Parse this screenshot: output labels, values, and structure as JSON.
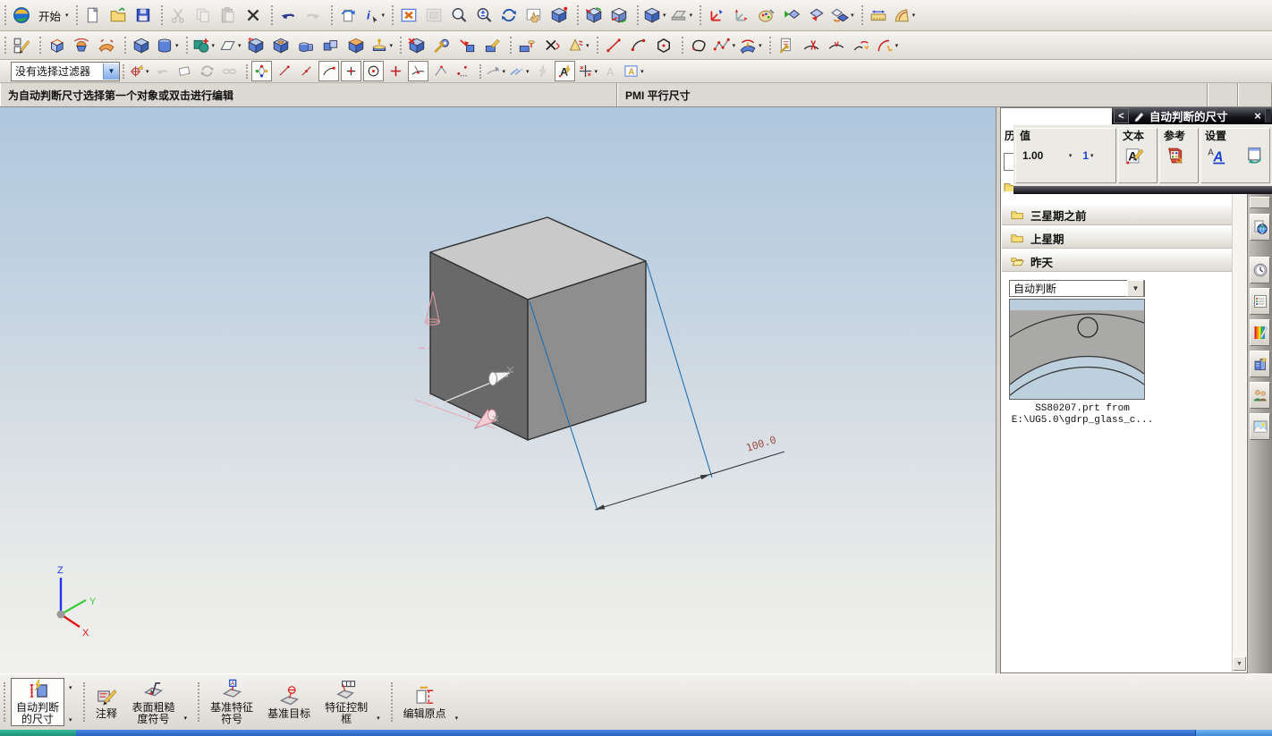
{
  "prompt": {
    "message": "为自动判断尺寸选择第一个对象或双击进行编辑",
    "status": "PMI  平行尺寸"
  },
  "toolbars": {
    "filter_value": "没有选择过滤器",
    "row1": {
      "groups": [
        {
          "items": [
            {
              "n": "nx-logo",
              "k": "logo",
              "static": true
            },
            {
              "n": "start-menu-button",
              "label": "开始",
              "dd": true
            }
          ]
        },
        {
          "items": [
            {
              "n": "new-file-button",
              "k": "doc"
            },
            {
              "n": "open-file-button",
              "k": "folder"
            },
            {
              "n": "save-button",
              "k": "floppy"
            }
          ]
        },
        {
          "items": [
            {
              "n": "cut-button",
              "k": "scissors",
              "dis": true
            },
            {
              "n": "copy-button",
              "k": "copy",
              "dis": true
            },
            {
              "n": "paste-button",
              "k": "paste",
              "dis": true
            },
            {
              "n": "delete-button",
              "k": "del"
            }
          ]
        },
        {
          "items": [
            {
              "n": "undo-button",
              "k": "undo"
            },
            {
              "n": "redo-button",
              "k": "redo",
              "dis": true
            }
          ]
        },
        {
          "items": [
            {
              "n": "refresh-display-button",
              "k": "docrot"
            },
            {
              "n": "information-button",
              "k": "info",
              "dd": true
            }
          ]
        },
        {
          "items": [
            {
              "n": "fit-view-button",
              "k": "winx"
            },
            {
              "n": "zoom-placeholder-button",
              "k": "winbox",
              "dis": true
            },
            {
              "n": "zoom-window-button",
              "k": "mag"
            },
            {
              "n": "zoom-in-out-button",
              "k": "magpm"
            },
            {
              "n": "rotate-view-button",
              "k": "orbit"
            },
            {
              "n": "pan-view-button",
              "k": "hand"
            },
            {
              "n": "shaded-display-button",
              "k": "cubedot"
            }
          ]
        },
        {
          "items": [
            {
              "n": "edit-work-section-button",
              "k": "sectioncube"
            },
            {
              "n": "clip-work-section-button",
              "k": "sectioncube2"
            }
          ]
        },
        {
          "items": [
            {
              "n": "rendering-style-button",
              "k": "cube",
              "dd": true
            },
            {
              "n": "flat-shadow-button",
              "k": "laptop",
              "dd": true
            }
          ]
        },
        {
          "items": [
            {
              "n": "wcs-dynamics-button",
              "k": "triad"
            },
            {
              "n": "wcs-orient-button",
              "k": "triadg"
            },
            {
              "n": "edit-object-display-button",
              "k": "painter"
            },
            {
              "n": "show-hide-button",
              "k": "diam1"
            },
            {
              "n": "immediate-hide-button",
              "k": "diam2"
            },
            {
              "n": "show-button",
              "k": "diam3",
              "dd": true
            }
          ]
        },
        {
          "items": [
            {
              "n": "measure-distance-button",
              "k": "ruler"
            },
            {
              "n": "measure-angle-button",
              "k": "protractor",
              "dd": true
            }
          ]
        }
      ]
    },
    "row2": {
      "groups": [
        {
          "items": [
            {
              "n": "sketch-button",
              "k": "sketchpencil"
            }
          ]
        },
        {
          "items": [
            {
              "n": "extrude-button",
              "k": "extrude"
            },
            {
              "n": "revolve-button",
              "k": "revolve"
            },
            {
              "n": "swept-button",
              "k": "sheet"
            }
          ]
        },
        {
          "items": [
            {
              "n": "block-button",
              "k": "cube"
            },
            {
              "n": "cylinder-button",
              "k": "cylinder",
              "dd": true
            }
          ]
        },
        {
          "items": [
            {
              "n": "unite-button",
              "k": "bool",
              "dd": true
            },
            {
              "n": "datum-plane-button",
              "k": "planeicon",
              "dd": true
            },
            {
              "n": "datum-csys-button",
              "k": "csys"
            },
            {
              "n": "hole-button",
              "k": "holebox"
            },
            {
              "n": "boss-button",
              "k": "boss"
            },
            {
              "n": "pad-button",
              "k": "twobox"
            },
            {
              "n": "shell-button",
              "k": "shellbox"
            },
            {
              "n": "offset-face-button",
              "k": "offsetup",
              "dd": true
            }
          ]
        },
        {
          "items": [
            {
              "n": "delete-face-button",
              "k": "redxbox"
            },
            {
              "n": "edit-feature-parameters-button",
              "k": "wrenchgear"
            },
            {
              "n": "replace-face-button",
              "k": "arrowbox"
            },
            {
              "n": "move-face-button",
              "k": "pencilbox"
            }
          ]
        },
        {
          "items": [
            {
              "n": "pattern-feature-button",
              "k": "cylarrowbox"
            },
            {
              "n": "chamfer-button",
              "k": "chamfx"
            },
            {
              "n": "draft-button",
              "k": "conedim",
              "dd": true
            }
          ]
        },
        {
          "items": [
            {
              "n": "line-button",
              "k": "line"
            },
            {
              "n": "arc-button",
              "k": "arc"
            },
            {
              "n": "polygon-button",
              "k": "poly"
            }
          ]
        },
        {
          "items": [
            {
              "n": "studio-spline-button",
              "k": "blobc"
            },
            {
              "n": "spline-button",
              "k": "spline",
              "dd": true
            },
            {
              "n": "through-curves-button",
              "k": "curvesheet",
              "dd": true
            }
          ]
        },
        {
          "items": [
            {
              "n": "edit-curve-parameters-button",
              "k": "wrenchdoc"
            },
            {
              "n": "trim-curve-button",
              "k": "trimc"
            },
            {
              "n": "divide-curve-button",
              "k": "divc"
            },
            {
              "n": "join-curve-button",
              "k": "joinc"
            },
            {
              "n": "edit-curve-fillet-button",
              "k": "fillc",
              "dd": true
            }
          ]
        }
      ]
    },
    "row3": {
      "groups": [
        {
          "items": [
            {
              "n": "snap-point-options-button",
              "k": "target",
              "dd": true
            },
            {
              "n": "previous-selection-button",
              "k": "grayback",
              "dis": true
            },
            {
              "n": "erase-highlight-button",
              "k": "eraserbox"
            },
            {
              "n": "rotate-selection-button",
              "k": "orbit",
              "dis": true
            },
            {
              "n": "chain-selection-button",
              "k": "chain",
              "dis": true
            }
          ]
        },
        {
          "items": [
            {
              "n": "enable-snap-point-button",
              "k": "snapmulti",
              "boxed": true
            },
            {
              "n": "end-point-snap-button",
              "k": "lineend"
            },
            {
              "n": "mid-point-snap-button",
              "k": "linemid"
            },
            {
              "n": "control-point-snap-button",
              "k": "curveend",
              "boxed": true
            },
            {
              "n": "intersection-snap-button",
              "k": "crosspt",
              "boxed": true
            },
            {
              "n": "arc-center-snap-button",
              "k": "circcenter",
              "boxed": true
            },
            {
              "n": "quadrant-snap-button",
              "k": "plus"
            },
            {
              "n": "existing-point-snap-button",
              "k": "pointarrow",
              "boxed": true
            },
            {
              "n": "point-on-curve-snap-button",
              "k": "angline"
            },
            {
              "n": "two-point-snap-button",
              "k": "twopoint"
            }
          ]
        },
        {
          "items": [
            {
              "n": "point-dialog-button",
              "k": "curvearrow",
              "dd": true
            },
            {
              "n": "vector-dialog-button",
              "k": "flowarrow",
              "dd": true
            },
            {
              "n": "flash-highlight-button",
              "k": "grayflash",
              "dis": true
            },
            {
              "n": "annotation-editor-button",
              "k": "Aflash",
              "boxed": true
            },
            {
              "n": "dimension-style-button",
              "k": "crossdim",
              "dd": true
            },
            {
              "n": "text-style-button",
              "k": "grayA",
              "dis": true
            },
            {
              "n": "annotation-preferences-button",
              "k": "Awin",
              "dd": true
            }
          ]
        }
      ]
    }
  },
  "dialog": {
    "title": "自动判断的尺寸",
    "back_label": "<",
    "close_label": "×",
    "value_group": {
      "label": "值",
      "value": "1.00",
      "precision": "1"
    },
    "text_group": {
      "label": "文本"
    },
    "reference_group": {
      "label": "参考"
    },
    "settings_group": {
      "label": "设置"
    }
  },
  "palette": {
    "header_partial": "历",
    "folders": [
      {
        "label": "三星期之前",
        "open": false
      },
      {
        "label": "上星期",
        "open": false
      },
      {
        "label": "昨天",
        "open": true
      }
    ],
    "type_dropdown": "自动判断",
    "preview": {
      "caption_line1": "SS80207.prt from",
      "caption_line2": "E:\\UG5.0\\gdrp_glass_c..."
    }
  },
  "resource_bar": {
    "items": [
      {
        "n": "web-browser-tab",
        "k": "globedoc"
      },
      {
        "n": "history-tab",
        "k": "clock",
        "gap": true
      },
      {
        "n": "part-navig",
        "k": "navwin"
      },
      {
        "n": "visual-effects-tab",
        "k": "rainbow"
      },
      {
        "n": "scene-navigator-tab",
        "k": "buildspark"
      },
      {
        "n": "roles-tab",
        "k": "people"
      },
      {
        "n": "background-images-tab",
        "k": "photo"
      }
    ]
  },
  "viewport": {
    "dimension_label": "100.0",
    "axes": {
      "x": "X",
      "y": "Y",
      "z": "Z"
    }
  },
  "bottom_toolbar": {
    "groups": [
      {
        "buttons": [
          {
            "n": "inferred-dimension-button",
            "k": "dimflash",
            "lines": [
              "自动判断",
              "的尺寸"
            ],
            "pressed": true,
            "side_arrows": true
          }
        ]
      },
      {
        "buttons": [
          {
            "n": "note-button",
            "k": "note",
            "lines": [
              "注释"
            ]
          },
          {
            "n": "surface-finish-symbol-button",
            "k": "surf",
            "lines": [
              "表面粗糙",
              "度符号"
            ]
          }
        ],
        "dd": true
      },
      {
        "buttons": [
          {
            "n": "datum-feature-symbol-button",
            "k": "datumflag",
            "lines": [
              "基准特征",
              "符号"
            ]
          },
          {
            "n": "datum-target-button",
            "k": "datumtarget",
            "lines": [
              "基准目标"
            ]
          },
          {
            "n": "feature-control-frame-button",
            "k": "fcf",
            "lines": [
              "特征控制",
              "框"
            ]
          }
        ],
        "dd": true
      },
      {
        "buttons": [
          {
            "n": "edit-origin-button",
            "k": "editorigin",
            "lines": [
              "编辑原点"
            ]
          }
        ],
        "dd": true
      }
    ]
  },
  "colors": {
    "extension_line": "#1f6fb0",
    "dimension_text": "#9c4f46",
    "cube_top": "#c9c9c9",
    "cube_left": "#696969",
    "cube_right": "#8e8e8e",
    "viewport_top": "#afc7de",
    "viewport_bottom": "#f1f1ef",
    "taskbar_green": "#2fae96",
    "taskbar_blue": "#3a77d6"
  }
}
